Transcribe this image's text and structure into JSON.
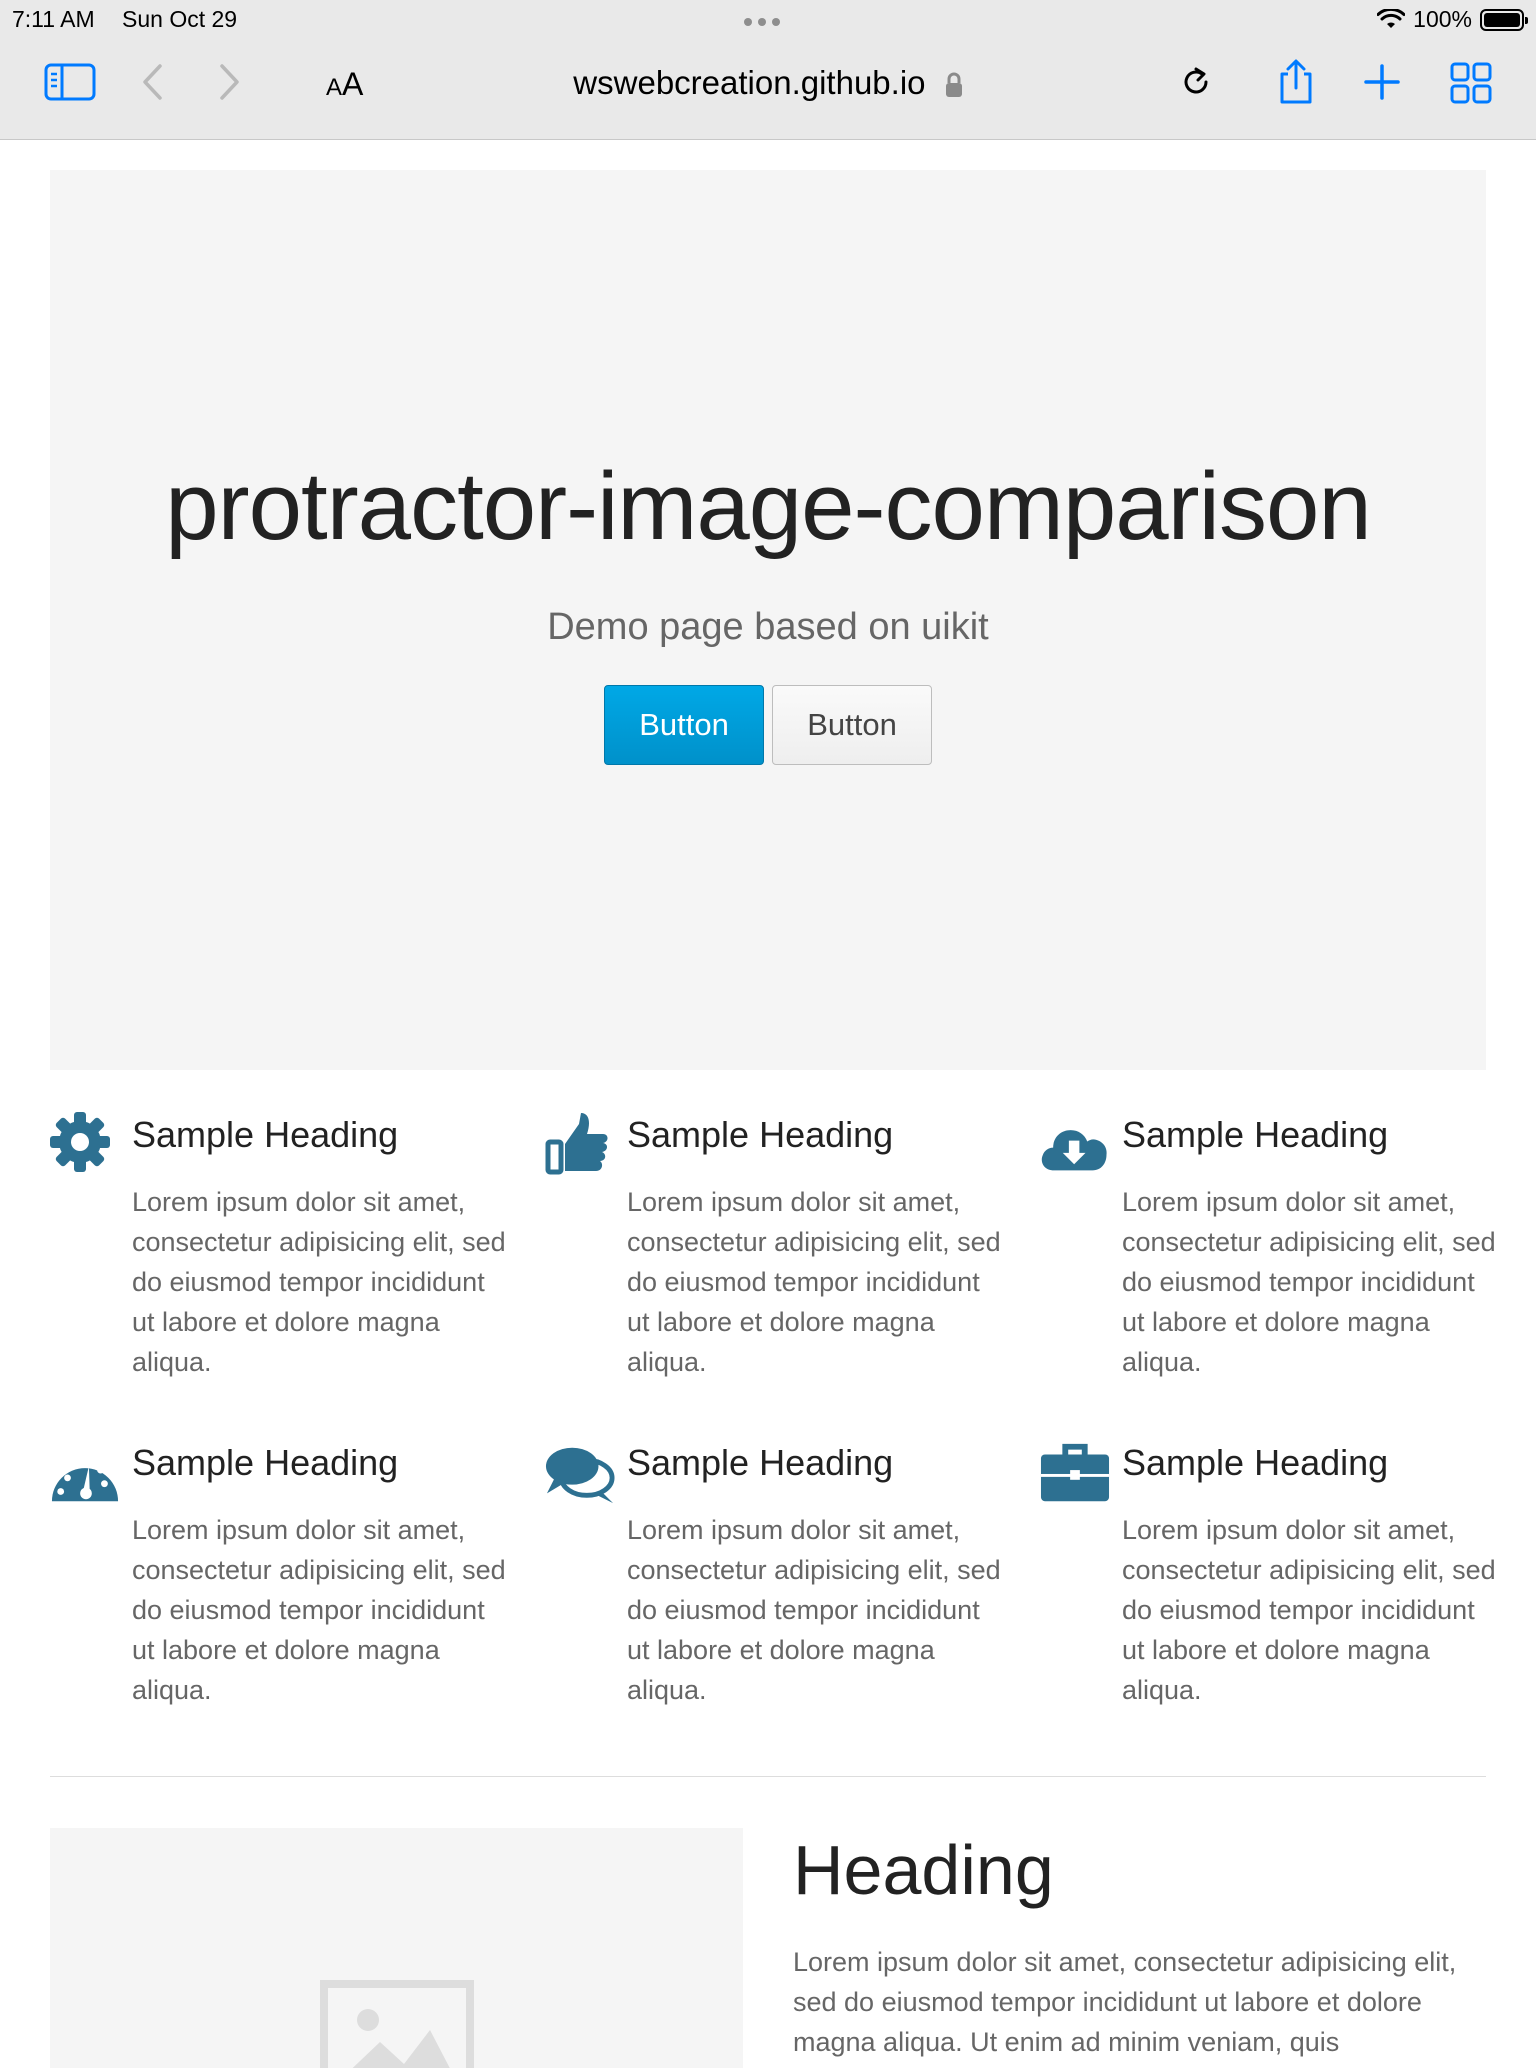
{
  "status_bar": {
    "time": "7:11 AM",
    "date": "Sun Oct 29",
    "battery": "100%"
  },
  "browser": {
    "text_size_small": "A",
    "text_size_large": "A",
    "url": "wswebcreation.github.io",
    "accent_color": "#007aff"
  },
  "hero": {
    "title": "protractor-image-comparison",
    "subtitle": "Demo page based on uikit",
    "primary_button": "Button",
    "secondary_button": "Button",
    "primary_color": "#00a8e6"
  },
  "features": [
    {
      "icon": "gear-icon",
      "heading": "Sample Heading",
      "text": "Lorem ipsum dolor sit amet, consectetur adipisicing elit, sed do eiusmod tempor incididunt ut labore et dolore magna aliqua."
    },
    {
      "icon": "thumbs-up-icon",
      "heading": "Sample Heading",
      "text": "Lorem ipsum dolor sit amet, consectetur adipisicing elit, sed do eiusmod tempor incididunt ut labore et dolore magna aliqua."
    },
    {
      "icon": "cloud-download-icon",
      "heading": "Sample Heading",
      "text": "Lorem ipsum dolor sit amet, consectetur adipisicing elit, sed do eiusmod tempor incididunt ut labore et dolore magna aliqua."
    },
    {
      "icon": "dashboard-icon",
      "heading": "Sample Heading",
      "text": "Lorem ipsum dolor sit amet, consectetur adipisicing elit, sed do eiusmod tempor incididunt ut labore et dolore magna aliqua."
    },
    {
      "icon": "comments-icon",
      "heading": "Sample Heading",
      "text": "Lorem ipsum dolor sit amet, consectetur adipisicing elit, sed do eiusmod tempor incididunt ut labore et dolore magna aliqua."
    },
    {
      "icon": "briefcase-icon",
      "heading": "Sample Heading",
      "text": "Lorem ipsum dolor sit amet, consectetur adipisicing elit, sed do eiusmod tempor incididunt ut labore et dolore magna aliqua."
    }
  ],
  "icon_color": "#2d7091",
  "bottom": {
    "heading": "Heading",
    "text": "Lorem ipsum dolor sit amet, consectetur adipisicing elit, sed do eiusmod tempor incididunt ut labore et dolore magna aliqua. Ut enim ad minim veniam, quis"
  }
}
